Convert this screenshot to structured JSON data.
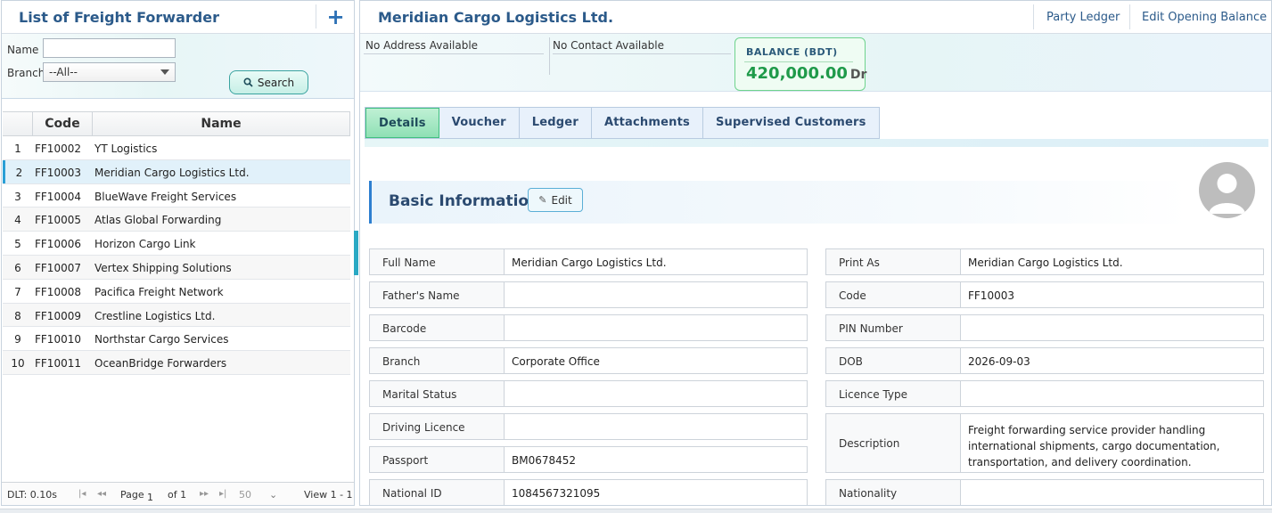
{
  "left": {
    "title": "List of Freight Forwarder",
    "filter": {
      "name_label": "Name",
      "name_value": "",
      "branch_label": "Branch",
      "branch_value": "--All--",
      "search_label": "Search"
    },
    "grid": {
      "headers": {
        "code": "Code",
        "name": "Name"
      },
      "rows": [
        {
          "num": "1",
          "code": "FF10002",
          "name": "YT Logistics"
        },
        {
          "num": "2",
          "code": "FF10003",
          "name": "Meridian Cargo Logistics Ltd."
        },
        {
          "num": "3",
          "code": "FF10004",
          "name": "BlueWave Freight Services"
        },
        {
          "num": "4",
          "code": "FF10005",
          "name": "Atlas Global Forwarding"
        },
        {
          "num": "5",
          "code": "FF10006",
          "name": "Horizon Cargo Link"
        },
        {
          "num": "6",
          "code": "FF10007",
          "name": "Vertex Shipping Solutions"
        },
        {
          "num": "7",
          "code": "FF10008",
          "name": "Pacifica Freight Network"
        },
        {
          "num": "8",
          "code": "FF10009",
          "name": "Crestline Logistics Ltd."
        },
        {
          "num": "9",
          "code": "FF10010",
          "name": "Northstar Cargo Services"
        },
        {
          "num": "10",
          "code": "FF10011",
          "name": "OceanBridge Forwarders"
        }
      ]
    },
    "pager": {
      "dlt": "DLT: 0.10s",
      "page_label": "Page",
      "page_value": "1",
      "of": "of 1",
      "page_size": "50",
      "view": "View 1 - 1"
    }
  },
  "right": {
    "title": "Meridian Cargo Logistics Ltd.",
    "links": {
      "party_ledger": "Party Ledger",
      "edit_opening_balance": "Edit Opening Balance"
    },
    "address": "No Address Available",
    "contact": "No Contact Available",
    "balance": {
      "label": "BALANCE (BDT)",
      "value": "420,000.00",
      "suffix": "Dr"
    },
    "tabs": [
      "Details",
      "Voucher",
      "Ledger",
      "Attachments",
      "Supervised Customers"
    ],
    "section": {
      "title": "Basic Information",
      "edit_label": "Edit"
    },
    "fields_left": [
      {
        "label": "Full Name",
        "value": "Meridian Cargo Logistics Ltd."
      },
      {
        "label": "Father's Name",
        "value": ""
      },
      {
        "label": "Barcode",
        "value": ""
      },
      {
        "label": "Branch",
        "value": "Corporate Office"
      },
      {
        "label": "Marital Status",
        "value": ""
      },
      {
        "label": "Driving Licence",
        "value": ""
      },
      {
        "label": "Passport",
        "value": "BM0678452"
      },
      {
        "label": "National ID",
        "value": "1084567321095"
      }
    ],
    "fields_right": [
      {
        "label": "Print As",
        "value": "Meridian Cargo Logistics Ltd."
      },
      {
        "label": "Code",
        "value": "FF10003"
      },
      {
        "label": "PIN Number",
        "value": ""
      },
      {
        "label": "DOB",
        "value": "2026-09-03"
      },
      {
        "label": "Licence Type",
        "value": ""
      },
      {
        "label": "Description",
        "value": "Freight forwarding service provider handling international shipments, cargo documentation, transportation, and delivery coordination."
      },
      {
        "label": "Nationality",
        "value": ""
      }
    ]
  }
}
